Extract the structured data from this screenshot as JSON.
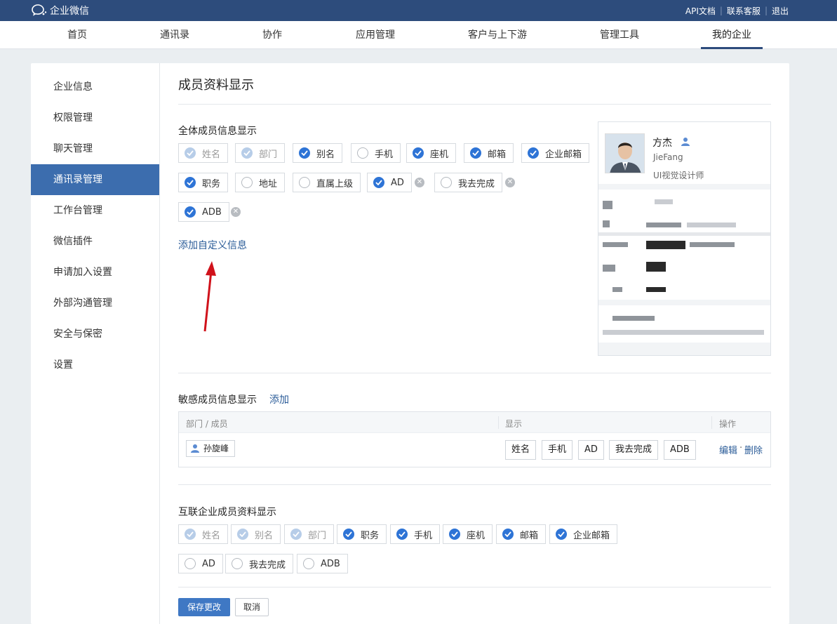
{
  "app": {
    "name": "企业微信"
  },
  "top_links": [
    "API文档",
    "联系客服",
    "退出"
  ],
  "nav": [
    "首页",
    "通讯录",
    "协作",
    "应用管理",
    "客户与上下游",
    "管理工具",
    "我的企业"
  ],
  "nav_active": "我的企业",
  "sidebar": [
    "企业信息",
    "权限管理",
    "聊天管理",
    "通讯录管理",
    "工作台管理",
    "微信插件",
    "申请加入设置",
    "外部沟通管理",
    "安全与保密",
    "设置"
  ],
  "sidebar_active": "通讯录管理",
  "page_title": "成员资料显示",
  "all_members": {
    "title": "全体成员信息显示",
    "fields": [
      {
        "label": "姓名",
        "state": "disabled-checked"
      },
      {
        "label": "部门",
        "state": "disabled-checked"
      },
      {
        "label": "别名",
        "state": "checked"
      },
      {
        "label": "手机",
        "state": "unchecked"
      },
      {
        "label": "座机",
        "state": "checked"
      },
      {
        "label": "邮箱",
        "state": "checked"
      },
      {
        "label": "企业邮箱",
        "state": "checked"
      },
      {
        "label": "职务",
        "state": "checked"
      },
      {
        "label": "地址",
        "state": "unchecked"
      },
      {
        "label": "直属上级",
        "state": "unchecked"
      },
      {
        "label": "AD",
        "state": "checked",
        "removable": true
      },
      {
        "label": "我去完成",
        "state": "unchecked",
        "removable": true
      },
      {
        "label": "ADB",
        "state": "checked",
        "removable": true
      }
    ],
    "add_custom": "添加自定义信息"
  },
  "preview": {
    "name": "方杰",
    "en_name": "JieFang",
    "title": "UI视觉设计师"
  },
  "sensitive": {
    "title": "敏感成员信息显示",
    "add": "添加",
    "columns": [
      "部门 / 成员",
      "显示",
      "操作"
    ],
    "rows": [
      {
        "member": "孙旋峰",
        "fields": [
          "姓名",
          "手机",
          "AD",
          "我去完成",
          "ADB"
        ],
        "edit": "编辑",
        "dot": "·",
        "delete": "删除"
      }
    ]
  },
  "interconnect": {
    "title": "互联企业成员资料显示",
    "fields": [
      {
        "label": "姓名",
        "state": "disabled-checked"
      },
      {
        "label": "别名",
        "state": "disabled-checked"
      },
      {
        "label": "部门",
        "state": "disabled-checked"
      },
      {
        "label": "职务",
        "state": "checked"
      },
      {
        "label": "手机",
        "state": "checked"
      },
      {
        "label": "座机",
        "state": "checked"
      },
      {
        "label": "邮箱",
        "state": "checked"
      },
      {
        "label": "企业邮箱",
        "state": "checked"
      },
      {
        "label": "AD",
        "state": "unchecked"
      },
      {
        "label": "我去完成",
        "state": "unchecked"
      },
      {
        "label": "ADB",
        "state": "unchecked"
      }
    ]
  },
  "buttons": {
    "save": "保存更改",
    "cancel": "取消"
  },
  "colors": {
    "topbar": "#2d4c7c",
    "accent": "#2e74d6",
    "sidebar_active": "#3c6dae",
    "arrow": "#d0121b"
  }
}
